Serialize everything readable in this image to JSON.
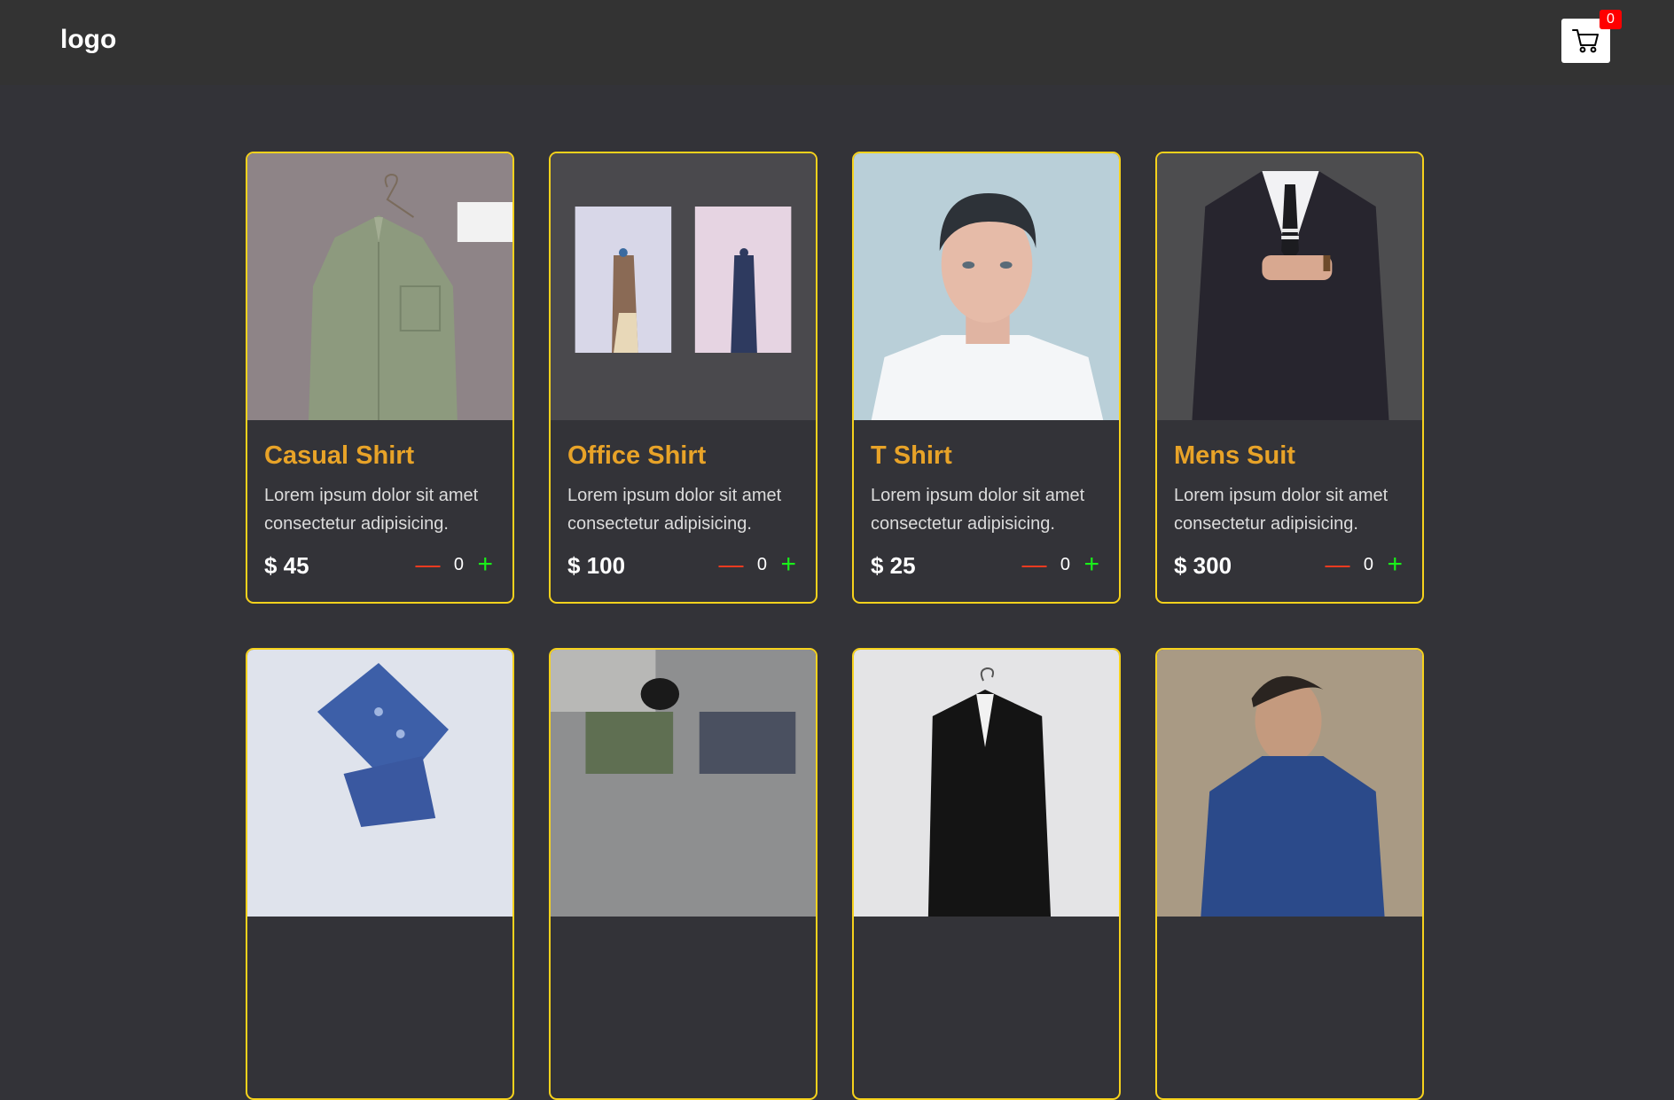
{
  "header": {
    "logo": "logo",
    "cart_count": "0"
  },
  "products": [
    {
      "title": "Casual Shirt",
      "desc": "Lorem ipsum dolor sit amet consectetur adipisicing.",
      "price": "$ 45",
      "qty": "0"
    },
    {
      "title": "Office Shirt",
      "desc": "Lorem ipsum dolor sit amet consectetur adipisicing.",
      "price": "$ 100",
      "qty": "0"
    },
    {
      "title": "T Shirt",
      "desc": "Lorem ipsum dolor sit amet consectetur adipisicing.",
      "price": "$ 25",
      "qty": "0"
    },
    {
      "title": "Mens Suit",
      "desc": "Lorem ipsum dolor sit amet consectetur adipisicing.",
      "price": "$ 300",
      "qty": "0"
    }
  ],
  "controls": {
    "minus": "—",
    "plus": "+"
  },
  "colors": {
    "accent": "#f6d21c",
    "title": "#e8a328",
    "minus": "#ff3b1f",
    "plus": "#19f019",
    "badge": "#ff0000"
  }
}
